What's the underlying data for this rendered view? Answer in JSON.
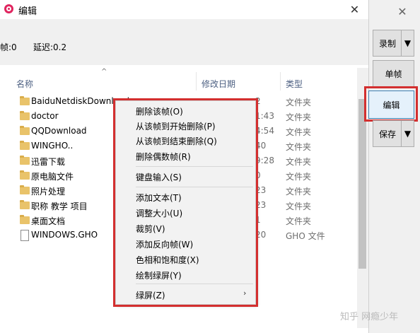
{
  "window": {
    "title": "编辑",
    "close_glyph": "✕"
  },
  "infobar": {
    "item1": "帧:0",
    "item2": "延迟:0.2"
  },
  "filelist": {
    "columns": {
      "name": "名称",
      "date": "修改日期",
      "type": "类型"
    },
    "rows": [
      {
        "name": "BaiduNetdiskDownload",
        "date": "2",
        "type": "文件夹",
        "icon": "folder-icon"
      },
      {
        "name": "doctor",
        "date": "1:43",
        "type": "文件夹",
        "icon": "folder-icon"
      },
      {
        "name": "QQDownload",
        "date": "4:54",
        "type": "文件夹",
        "icon": "folder-icon"
      },
      {
        "name": "WINGHO..",
        "date": "40",
        "type": "文件夹",
        "icon": "folder-icon"
      },
      {
        "name": "迅雷下载",
        "date": "9:28",
        "type": "文件夹",
        "icon": "folder-icon"
      },
      {
        "name": "原电脑文件",
        "date": "0",
        "type": "文件夹",
        "icon": "folder-icon"
      },
      {
        "name": "照片处理",
        "date": "23",
        "type": "文件夹",
        "icon": "folder-icon"
      },
      {
        "name": "职称 教学 项目",
        "date": "23",
        "type": "文件夹",
        "icon": "folder-icon"
      },
      {
        "name": "桌面文档",
        "date": "1",
        "type": "文件夹",
        "icon": "folder-icon"
      },
      {
        "name": "WINDOWS.GHO",
        "date": "20",
        "type": "GHO 文件",
        "icon": "file-icon"
      }
    ]
  },
  "right_panel": {
    "close_glyph": "✕",
    "record_label": "录制",
    "single_frame_label": "单帧",
    "edit_label": "编辑",
    "save_label": "保存",
    "dropdown_glyph": "▼"
  },
  "context_menu": {
    "items": [
      "删除该帧(O)",
      "从该帧到开始删除(P)",
      "从该帧到结束删除(Q)",
      "删除偶数帧(R)",
      "键盘输入(S)",
      "添加文本(T)",
      "调整大小(U)",
      "裁剪(V)",
      "添加反向帧(W)",
      "色相和饱和度(X)",
      "绘制绿屏(Y)",
      "绿屏(Z)"
    ],
    "submenu_glyph": "›"
  },
  "watermark": "知乎 网瘾少年",
  "colors": {
    "highlight": "#d32f2f",
    "folder": "#e9c36a"
  }
}
